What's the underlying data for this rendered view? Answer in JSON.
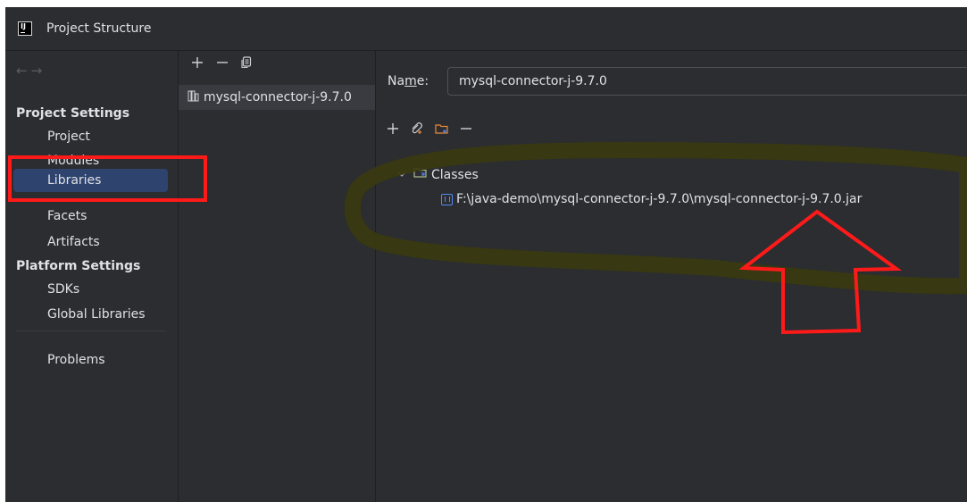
{
  "window": {
    "title": "Project Structure",
    "app_icon": "intellij-idea-icon"
  },
  "sidebar": {
    "nav_back_icon": "arrow-left-icon",
    "nav_forward_icon": "arrow-right-icon",
    "project_settings_title": "Project Settings",
    "project_settings_items": [
      {
        "label": "Project"
      },
      {
        "label": "Modules"
      },
      {
        "label": "Libraries",
        "selected": true
      },
      {
        "label": "Facets"
      },
      {
        "label": "Artifacts"
      }
    ],
    "platform_settings_title": "Platform Settings",
    "platform_settings_items": [
      {
        "label": "SDKs"
      },
      {
        "label": "Global Libraries"
      }
    ],
    "problems_label": "Problems"
  },
  "libraries_panel": {
    "toolbar_icons": [
      "plus-icon",
      "minus-icon",
      "copy-icon"
    ],
    "items": [
      {
        "label": "mysql-connector-j-9.7.0",
        "icon": "library-icon"
      }
    ]
  },
  "details": {
    "name_label_prefix": "Na",
    "name_label_mnemonic": "m",
    "name_label_suffix": "e:",
    "name_value": "mysql-connector-j-9.7.0",
    "toolbar_icons": [
      "plus-icon",
      "attach-icon",
      "add-folder-icon",
      "minus-icon"
    ],
    "tree": {
      "classes_label": "Classes",
      "jar_path": "F:\\java-demo\\mysql-connector-j-9.7.0\\mysql-connector-j-9.7.0.jar"
    }
  },
  "annotations": {
    "highlight_color": "#ff1a1a",
    "marker_color": "#3a3a10"
  },
  "colors": {
    "background": "#2b2d30",
    "selected": "#2e436e",
    "accent_blue": "#548af7"
  }
}
